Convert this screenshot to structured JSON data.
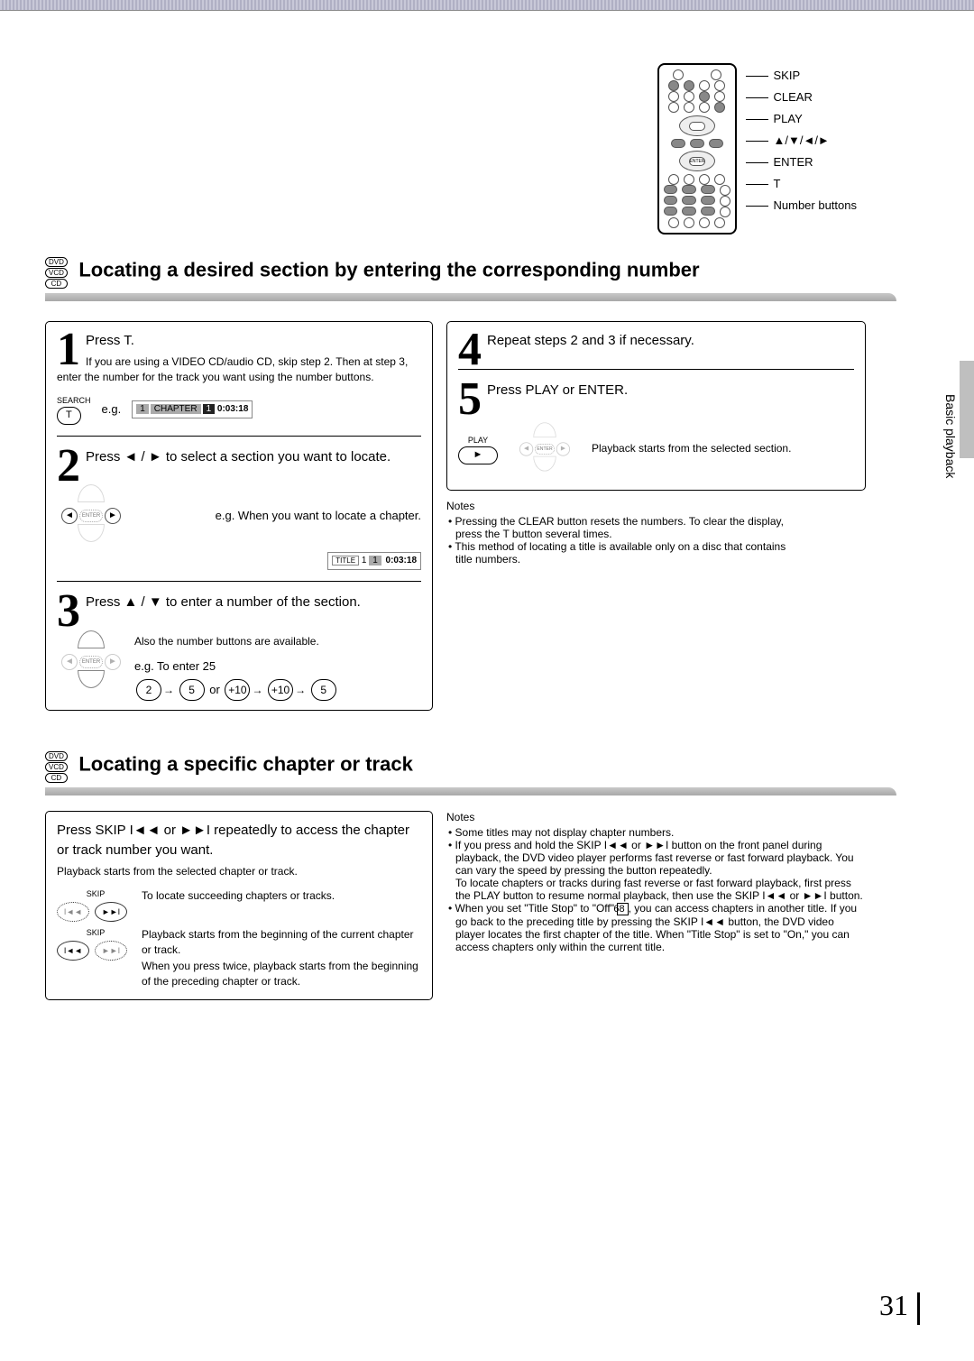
{
  "remote_labels": {
    "skip": "SKIP",
    "clear": "CLEAR",
    "play": "PLAY",
    "arrows": "▲/▼/◄/►",
    "enter": "ENTER",
    "t": "T",
    "number": "Number buttons"
  },
  "vtab": "Basic playback",
  "head1": {
    "title": "Locating a desired section by entering the corresponding number",
    "discs": [
      "DVD",
      "VCD",
      "CD"
    ]
  },
  "step1": {
    "title": "Press T.",
    "sub": "If you are using a VIDEO CD/audio CD, skip step 2. Then at step 3, enter the number for the track you want using the number buttons.",
    "keylbl": "SEARCH",
    "key": "T",
    "eg": "e.g.",
    "disp_a": "1",
    "disp_b": "CHAPTER",
    "disp_c": "1",
    "disp_t": "0:03:18"
  },
  "step2": {
    "title": "Press ◄ / ► to select a section you want to locate.",
    "eg": "e.g. When you want to locate a chapter.",
    "disp_a": "TITLE",
    "disp_b": "1",
    "disp_c": "1",
    "disp_t": "0:03:18"
  },
  "step3": {
    "title": "Press ▲ / ▼ to enter a number of the section.",
    "sub": "Also the number buttons are available.",
    "eg": "e.g. To enter 25",
    "k1": "2",
    "k2": "5",
    "or": "or",
    "k3": "+10",
    "k4": "+10",
    "k5": "5"
  },
  "step4": {
    "title": "Repeat steps 2 and 3 if necessary."
  },
  "step5": {
    "title": "Press PLAY or ENTER.",
    "keylbl": "PLAY",
    "key": "►",
    "sub": "Playback starts from the selected section.",
    "enter": "ENTER"
  },
  "notes1": {
    "t": "Notes",
    "a": "Pressing the CLEAR button resets the numbers. To clear the display, press the T button several times.",
    "b": "This method of locating a title is available only on a disc that contains title numbers."
  },
  "head2": {
    "title": "Locating a specific chapter or track",
    "discs": [
      "DVD",
      "VCD",
      "CD"
    ]
  },
  "sec2": {
    "title": "Press SKIP I◄◄ or ►►I repeatedly to access the chapter or track number you want.",
    "sub": "Playback starts from the selected chapter or track.",
    "skip_lbl": "SKIP",
    "fwd": "►►I",
    "fwd_txt": "To locate succeeding chapters or tracks.",
    "rev": "I◄◄",
    "rev_txt": "Playback starts from the beginning of the current chapter or track.\nWhen you press twice, playback starts from the beginning of the preceding chapter or track."
  },
  "notes2": {
    "t": "Notes",
    "a": "Some titles may not display chapter numbers.",
    "b_pre": "If you press and hold the SKIP I◄◄ or ►►I button on the front panel during playback, the DVD video player performs fast reverse or fast forward playback. You can vary the speed by pressing the button repeatedly.\nTo locate chapters or tracks during fast reverse or fast forward playback, first press the PLAY button to resume normal playback, then use the SKIP I◄◄ or ►►I button.",
    "c_pre": "When you set \"Title Stop\" to \"Off\" ",
    "c_ref": "68",
    "c_post": ", you can access chapters in another title. If you go back to the preceding title by pressing the SKIP I◄◄ button, the DVD video player locates the first chapter of the title. When \"Title Stop\" is set to \"On,\" you can access chapters only within the current title."
  },
  "page_num": "31"
}
